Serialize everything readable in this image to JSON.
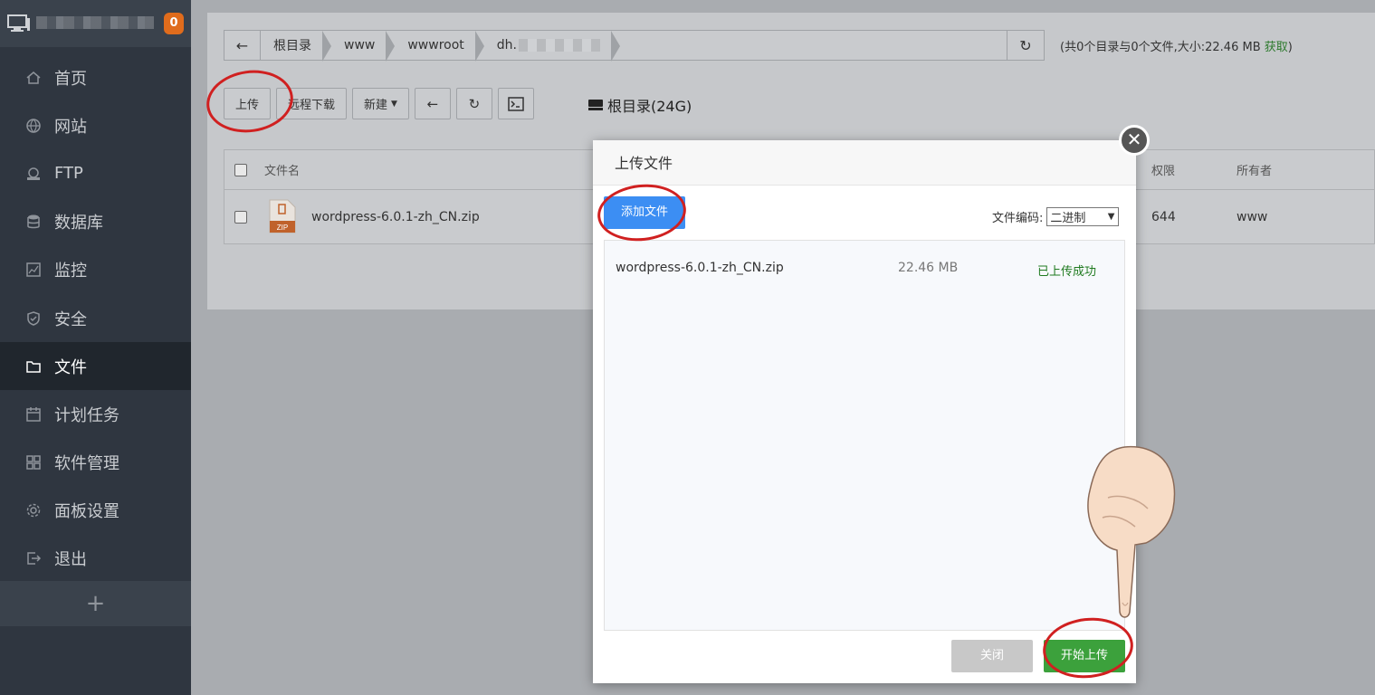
{
  "sidebar": {
    "badge": "0",
    "items": [
      {
        "label": "首页",
        "icon": "home-icon",
        "active": false
      },
      {
        "label": "网站",
        "icon": "globe-icon",
        "active": false
      },
      {
        "label": "FTP",
        "icon": "ftp-icon",
        "active": false
      },
      {
        "label": "数据库",
        "icon": "database-icon",
        "active": false
      },
      {
        "label": "监控",
        "icon": "monitor-icon",
        "active": false
      },
      {
        "label": "安全",
        "icon": "shield-icon",
        "active": false
      },
      {
        "label": "文件",
        "icon": "folder-icon",
        "active": true
      },
      {
        "label": "计划任务",
        "icon": "calendar-icon",
        "active": false
      },
      {
        "label": "软件管理",
        "icon": "grid-icon",
        "active": false
      },
      {
        "label": "面板设置",
        "icon": "gear-icon",
        "active": false
      },
      {
        "label": "退出",
        "icon": "logout-icon",
        "active": false
      }
    ],
    "add": "+"
  },
  "breadcrumb": {
    "items": [
      "根目录",
      "www",
      "wwwroot",
      "dh."
    ]
  },
  "stats": {
    "text": "(共0个目录与0个文件,大小:22.46 MB",
    "get": "获取",
    "close_paren": ")"
  },
  "toolbar": {
    "upload": "上传",
    "remote_download": "远程下载",
    "new": "新建",
    "disk": "根目录(24G)"
  },
  "table": {
    "headers": {
      "name": "文件名",
      "perm": "权限",
      "owner": "所有者"
    },
    "rows": [
      {
        "name": "wordpress-6.0.1-zh_CN.zip",
        "perm": "644",
        "owner": "www"
      }
    ]
  },
  "modal": {
    "title": "上传文件",
    "add_file": "添加文件",
    "encoding_label": "文件编码:",
    "encoding_value": "二进制",
    "file": {
      "name": "wordpress-6.0.1-zh_CN.zip",
      "size": "22.46 MB",
      "status": "已上传成功"
    },
    "close": "关闭",
    "start_upload": "开始上传"
  },
  "colors": {
    "sidebar_bg": "#2f3640",
    "primary_blue": "#3c8ef3",
    "success_green": "#3ca13c",
    "badge_orange": "#e06c1c",
    "annotation_red": "#d02020"
  }
}
